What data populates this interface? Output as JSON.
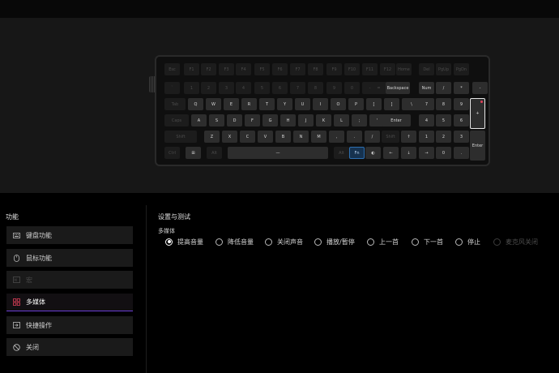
{
  "keyboard": {
    "row_fn": [
      "Esc",
      "F1",
      "F2",
      "F3",
      "F4",
      "F5",
      "F6",
      "F7",
      "F8",
      "F9",
      "F10",
      "F11",
      "F12",
      "Home",
      "Del",
      "PgUp",
      "PgDn"
    ],
    "row_num": [
      "`",
      "1",
      "2",
      "3",
      "4",
      "5",
      "6",
      "7",
      "8",
      "9",
      "0",
      "-",
      "=",
      "Backspace",
      "Num",
      "/",
      "*",
      "-"
    ],
    "row_q": [
      "Tab",
      "Q",
      "W",
      "E",
      "R",
      "T",
      "Y",
      "U",
      "I",
      "O",
      "P",
      "[",
      "]",
      "\\",
      "7",
      "8",
      "9"
    ],
    "row_a": [
      "Caps",
      "A",
      "S",
      "D",
      "F",
      "G",
      "H",
      "J",
      "K",
      "L",
      ";",
      "'",
      "Enter",
      "4",
      "5",
      "6"
    ],
    "row_z": [
      "Shift",
      "Z",
      "X",
      "C",
      "V",
      "B",
      "N",
      "M",
      ",",
      ".",
      "/",
      "Shift",
      "↑",
      "1",
      "2",
      "3"
    ],
    "row_ctrl": [
      "Ctrl",
      "⊞",
      "Alt",
      "—",
      "Alt",
      "Fn",
      "◐",
      "←",
      "↓",
      "→",
      "0",
      "."
    ],
    "numpad_plus": "+",
    "numpad_enter": "Enter"
  },
  "sidebar": {
    "title": "功能",
    "items": [
      {
        "label": "键盘功能",
        "icon": "keyboard-icon"
      },
      {
        "label": "鼠标功能",
        "icon": "mouse-icon"
      },
      {
        "label": "宏",
        "icon": "macro-icon"
      },
      {
        "label": "多媒体",
        "icon": "multimedia-icon"
      },
      {
        "label": "快捷操作",
        "icon": "shortcut-icon"
      },
      {
        "label": "关闭",
        "icon": "disable-icon"
      }
    ]
  },
  "panel": {
    "title": "设置与测试",
    "group_label": "多媒体",
    "options": [
      "提高音量",
      "降低音量",
      "关闭声音",
      "播放/暂停",
      "上一首",
      "下一首",
      "停止",
      "麦克风关闭"
    ],
    "selected": "提高音量"
  },
  "colors": {
    "accent": "#6b3fd8",
    "media_icon": "#e0405a",
    "fn_key": "#2e6fb0"
  }
}
